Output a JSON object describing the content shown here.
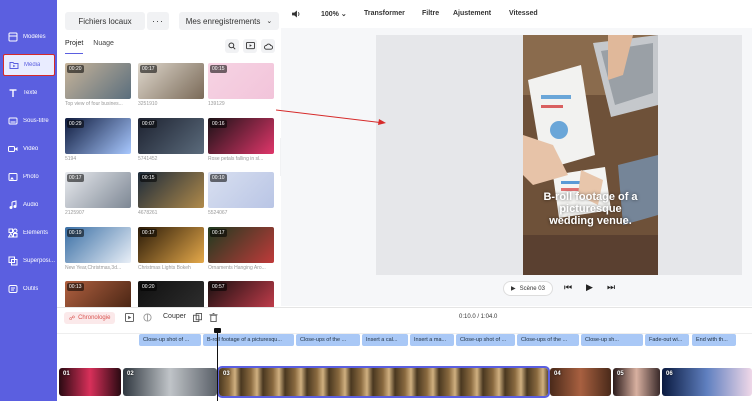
{
  "sidebar": {
    "accent": "#5b5fe0",
    "items": [
      {
        "label": "Modèles",
        "icon": "templates-icon",
        "active": false
      },
      {
        "label": "Média",
        "icon": "folder-media-icon",
        "active": true
      },
      {
        "label": "Texte",
        "icon": "text-icon",
        "active": false
      },
      {
        "label": "Sous-titre",
        "icon": "subtitle-icon",
        "active": false
      },
      {
        "label": "Vidéo",
        "icon": "video-icon",
        "active": false
      },
      {
        "label": "Photo",
        "icon": "photo-icon",
        "active": false
      },
      {
        "label": "Audio",
        "icon": "audio-icon",
        "active": false
      },
      {
        "label": "Éléments",
        "icon": "elements-icon",
        "active": false
      },
      {
        "label": "Superposi...",
        "icon": "overlay-icon",
        "active": false
      },
      {
        "label": "Outils",
        "icon": "tools-icon",
        "active": false
      }
    ]
  },
  "panel": {
    "local_files_label": "Fichiers locaux",
    "more_label": "···",
    "recordings_label": "Mes enregistrements",
    "tabs": [
      "Projet",
      "Nuage"
    ],
    "thumbs": [
      {
        "dur": "00:20",
        "cap": "Top view of four busines...",
        "c1": "#c7b49a",
        "c2": "#5a6e7d"
      },
      {
        "dur": "00:17",
        "cap": "3251910",
        "c1": "#ded7cc",
        "c2": "#7a6a58"
      },
      {
        "dur": "00:15",
        "cap": "139129",
        "c1": "#f6d3e3",
        "c2": "#f2c4da"
      },
      {
        "dur": "00:29",
        "cap": "5194",
        "c1": "#0f1b3d",
        "c2": "#a8c8ff"
      },
      {
        "dur": "00:07",
        "cap": "5741452",
        "c1": "#1d2230",
        "c2": "#5b6b7c"
      },
      {
        "dur": "00:16",
        "cap": "Rose petals falling in sl...",
        "c1": "#1a1216",
        "c2": "#e0366a"
      },
      {
        "dur": "00:17",
        "cap": "2125907",
        "c1": "#e8eaee",
        "c2": "#7d8794"
      },
      {
        "dur": "00:15",
        "cap": "4678261",
        "c1": "#1c2a3a",
        "c2": "#b08a4a"
      },
      {
        "dur": "00:10",
        "cap": "5524067",
        "c1": "#d8dff0",
        "c2": "#b9c5e5"
      },
      {
        "dur": "00:19",
        "cap": "New Year,Christmas,3d...",
        "c1": "#3a6fa5",
        "c2": "#e9eff7"
      },
      {
        "dur": "00:17",
        "cap": "Christmas Lights Bokeh",
        "c1": "#2a1a08",
        "c2": "#e5a94a"
      },
      {
        "dur": "00:17",
        "cap": "Ornaments Hanging Aro...",
        "c1": "#1f3a1f",
        "c2": "#c03a3a"
      },
      {
        "dur": "00:13",
        "cap": "",
        "c1": "#b06040",
        "c2": "#402010"
      },
      {
        "dur": "00:20",
        "cap": "",
        "c1": "#101010",
        "c2": "#303030"
      },
      {
        "dur": "00:57",
        "cap": "",
        "c1": "#1a1010",
        "c2": "#d04050"
      }
    ]
  },
  "toolbar": {
    "zoom": "100%",
    "transform": "Transformer",
    "filter": "Filtre",
    "adjust": "Ajustement",
    "speed": "Vitessed"
  },
  "preview": {
    "caption": "B-roll footage of a picturesque wedding venue.",
    "scene_label": "Scène 03"
  },
  "timeline": {
    "chronology_label": "Chronologie",
    "cut_label": "Couper",
    "timecode": "0:10.0 / 1:04.0",
    "captions": [
      "Close-up shot of ...",
      "B-roll footage of a picturesqu...",
      "Close-ups of the ...",
      "Insert a cal...",
      "Insert a ma...",
      "Close-up shot of ...",
      "Close-ups of the ...",
      "Close-up sh...",
      "Fade-out wi...",
      "End with th..."
    ],
    "clips": [
      "01",
      "02",
      "03",
      "04",
      "05",
      "06"
    ]
  }
}
